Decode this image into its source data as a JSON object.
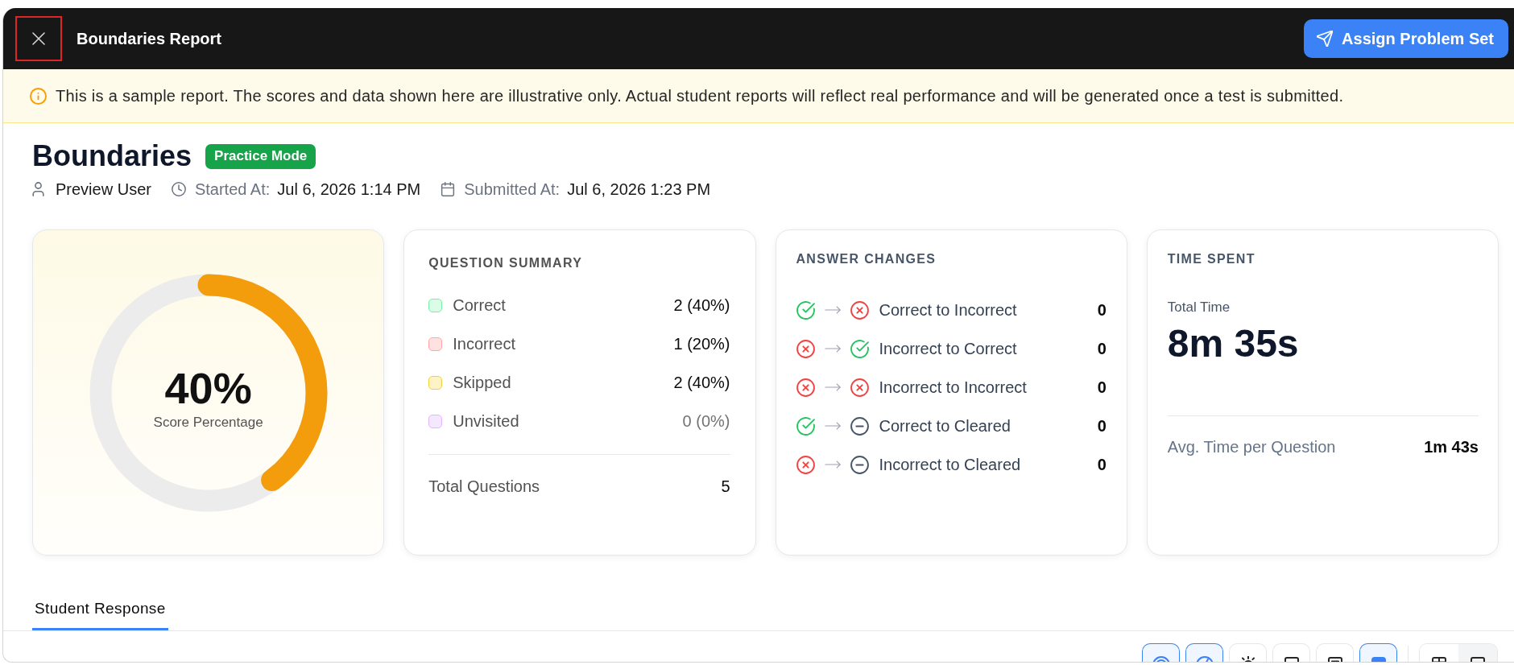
{
  "header": {
    "close": {
      "highlighted": true
    },
    "title": "Boundaries Report",
    "action": {
      "label": "Assign Problem Set"
    }
  },
  "notice": {
    "text": "This is a sample report. The scores and data shown here are illustrative only. Actual student reports will reflect real performance and will be generated once a test is submitted."
  },
  "report": {
    "title": "Boundaries",
    "badge": "Practice Mode",
    "meta": [
      {
        "kind": "user",
        "value": "Preview User"
      },
      {
        "kind": "clock",
        "label": "Started At:",
        "value": "Jul 6, 2026 1:14 PM"
      },
      {
        "kind": "calendar",
        "label": "Submitted At:",
        "value": "Jul 6, 2026 1:23 PM"
      }
    ]
  },
  "score_card": {
    "value": "40%",
    "caption": "Score Percentage",
    "level": 0.4
  },
  "question_summary": {
    "title": "QUESTION SUMMARY",
    "items": [
      {
        "label": "Correct",
        "value": "2 (40%)",
        "color": "#dcfce7",
        "dimmed": false
      },
      {
        "label": "Incorrect",
        "value": "1 (20%)",
        "color": "#fee2e2",
        "dimmed": false
      },
      {
        "label": "Skipped",
        "value": "2 (40%)",
        "color": "#fef3c7",
        "dimmed": false
      },
      {
        "label": "Unvisited",
        "value": "0 (0%)",
        "color": "#f3e8ff",
        "dimmed": true
      }
    ],
    "total": {
      "label": "Total Questions",
      "value": "5"
    }
  },
  "answer_changes": {
    "title": "ANSWER CHANGES",
    "items": [
      {
        "from": {
          "kind": "correct"
        },
        "to": {
          "kind": "incorrect"
        },
        "label": "Correct to Incorrect",
        "value": "0"
      },
      {
        "from": {
          "kind": "incorrect"
        },
        "to": {
          "kind": "correct"
        },
        "label": "Incorrect to Correct",
        "value": "0"
      },
      {
        "from": {
          "kind": "incorrect"
        },
        "to": {
          "kind": "incorrect"
        },
        "label": "Incorrect to Incorrect",
        "value": "0"
      },
      {
        "from": {
          "kind": "correct"
        },
        "to": {
          "kind": "cleared"
        },
        "label": "Correct to Cleared",
        "value": "0"
      },
      {
        "from": {
          "kind": "incorrect"
        },
        "to": {
          "kind": "cleared"
        },
        "label": "Incorrect to Cleared",
        "value": "0"
      }
    ]
  },
  "time_spent": {
    "title": "TIME SPENT",
    "total": {
      "label": "Total Time",
      "value": "8m 35s"
    },
    "rows": [
      {
        "label": "Avg. Time per Question",
        "value": "1m 43s"
      }
    ]
  },
  "tabs": [
    {
      "label": "Student Response",
      "selected": true
    }
  ],
  "toolbar": {
    "tools": [
      {
        "kind": "target",
        "selected": true
      },
      {
        "kind": "gauge",
        "selected": true
      },
      {
        "kind": "sun",
        "selected": false
      },
      {
        "kind": "square",
        "selected": false
      },
      {
        "kind": "document",
        "selected": false
      },
      {
        "kind": "block",
        "selected": true
      }
    ],
    "views": [
      {
        "kind": "layout",
        "selected": false
      },
      {
        "kind": "square",
        "selected": true
      }
    ]
  }
}
